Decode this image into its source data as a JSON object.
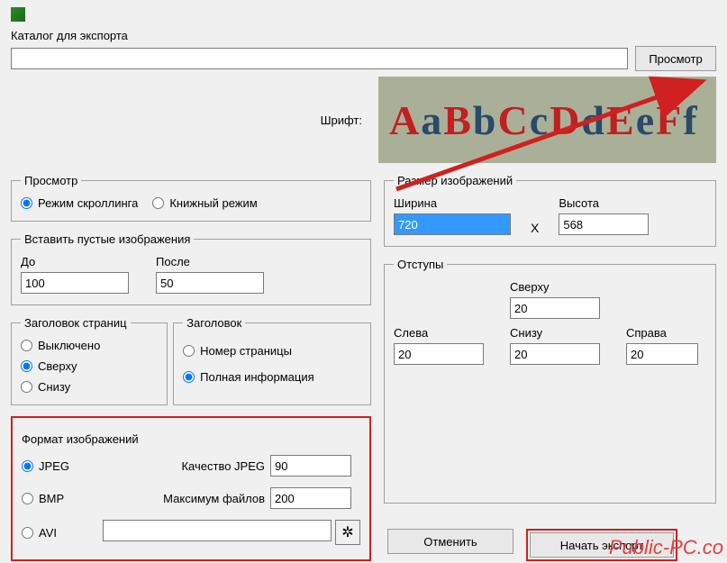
{
  "catalog": {
    "label": "Каталог для экспорта",
    "path": "",
    "browse_btn": "Просмотр"
  },
  "font": {
    "label": "Шрифт:",
    "sample": "AaBbCcDdEeFf"
  },
  "preview": {
    "legend": "Просмотр",
    "scroll_mode": "Режим скроллинга",
    "book_mode": "Книжный режим"
  },
  "empty_images": {
    "legend": "Вставить пустые изображения",
    "before_label": "До",
    "before_value": "100",
    "after_label": "После",
    "after_value": "50"
  },
  "pages_header": {
    "legend": "Заголовок страниц",
    "off": "Выключено",
    "top": "Сверху",
    "bottom": "Снизу"
  },
  "header": {
    "legend": "Заголовок",
    "page_number": "Номер страницы",
    "full_info": "Полная информация"
  },
  "image_format": {
    "legend": "Формат изображений",
    "jpeg": "JPEG",
    "bmp": "BMP",
    "avi": "AVI",
    "quality_label": "Качество JPEG",
    "quality_value": "90",
    "max_files_label": "Максимум файлов",
    "max_files_value": "200",
    "avi_path": ""
  },
  "image_size": {
    "legend": "Размер изображений",
    "width_label": "Ширина",
    "width_value": "720",
    "height_label": "Высота",
    "height_value": "568",
    "x": "X"
  },
  "margins": {
    "legend": "Отступы",
    "top_label": "Сверху",
    "top_value": "20",
    "left_label": "Слева",
    "left_value": "20",
    "right_label": "Справа",
    "right_value": "20",
    "bottom_label": "Снизу",
    "bottom_value": "20"
  },
  "buttons": {
    "cancel": "Отменить",
    "start": "Начать экспорт"
  },
  "watermark": "Public-PC.co"
}
